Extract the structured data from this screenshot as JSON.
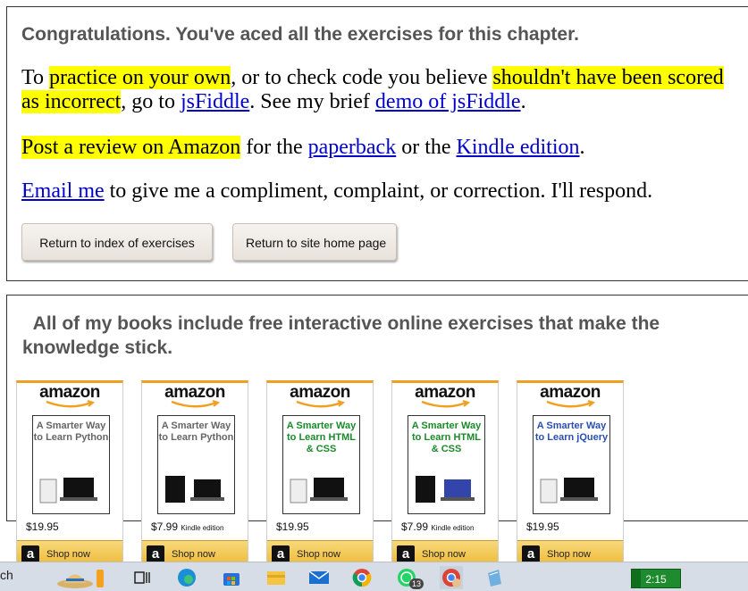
{
  "top_panel": {
    "heading": "Congratulations. You've aced all the exercises for this chapter.",
    "para1": {
      "t1": "To ",
      "h1": "practice on your own",
      "t2": ", or to check code you believe ",
      "h2": "shouldn't have been scored as incorrect",
      "t3": ", go to ",
      "link1": "jsFiddle",
      "t4": ". See my brief ",
      "link2": "demo of jsFiddle",
      "t5": "."
    },
    "para2": {
      "h1": "Post a review on Amazon",
      "t1": " for the ",
      "link1": "paperback",
      "t2": " or the ",
      "link2": "Kindle edition",
      "t3": "."
    },
    "para3": {
      "link1": "Email me",
      "t1": " to give me a compliment, complaint, or correction. I'll respond."
    },
    "buttons": {
      "index": "Return to index of exercises",
      "home": "Return to site home page"
    }
  },
  "books_panel": {
    "heading": "All of my books include free interactive online exercises that make the knowledge stick.",
    "books": [
      {
        "brand": "amazon",
        "title": "A Smarter Way to Learn Python",
        "price": "$19.95",
        "format": "",
        "shop": "Shop now",
        "color": "#666666"
      },
      {
        "brand": "amazon",
        "title": "A Smarter Way to Learn Python",
        "price": "$7.99",
        "format": "Kindle edition",
        "shop": "Shop now",
        "color": "#666666"
      },
      {
        "brand": "amazon",
        "title": "A Smarter Way to Learn HTML & CSS",
        "price": "$19.95",
        "format": "",
        "shop": "Shop now",
        "color": "#1a8a2a"
      },
      {
        "brand": "amazon",
        "title": "A Smarter Way to Learn HTML & CSS",
        "price": "$7.99",
        "format": "Kindle edition",
        "shop": "Shop now",
        "color": "#1a8a2a"
      },
      {
        "brand": "amazon",
        "title": "A Smarter Way to Learn jQuery",
        "price": "$19.95",
        "format": "",
        "shop": "Shop now",
        "color": "#2a4fb0"
      }
    ]
  },
  "taskbar": {
    "search_fragment": "ch",
    "clock": "2:15",
    "whatsapp_badge": "13",
    "icons": [
      "beach-hat-icon",
      "task-view-icon",
      "edge-icon",
      "store-icon",
      "file-explorer-icon",
      "mail-icon",
      "chrome-icon",
      "whatsapp-icon",
      "chrome-profile-icon",
      "notepad-icon"
    ]
  }
}
